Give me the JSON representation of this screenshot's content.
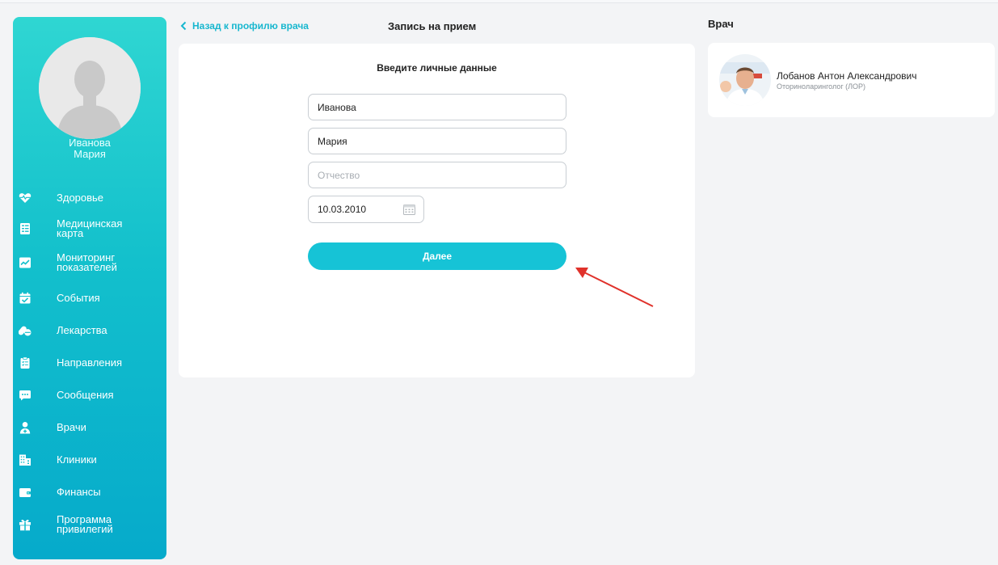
{
  "user": {
    "name": "Иванова\nМария"
  },
  "sidebar": {
    "items": [
      {
        "label": "Здоровье",
        "icon": "heart-pulse-icon"
      },
      {
        "label": "Медицинская\nкарта",
        "icon": "medical-card-icon"
      },
      {
        "label": "Мониторинг\nпоказателей",
        "icon": "monitoring-chart-icon"
      },
      {
        "label": "События",
        "icon": "calendar-check-icon"
      },
      {
        "label": "Лекарства",
        "icon": "pills-icon"
      },
      {
        "label": "Направления",
        "icon": "clipboard-icon"
      },
      {
        "label": "Сообщения",
        "icon": "chat-icon"
      },
      {
        "label": "Врачи",
        "icon": "doctor-icon"
      },
      {
        "label": "Клиники",
        "icon": "building-icon"
      },
      {
        "label": "Финансы",
        "icon": "wallet-icon"
      },
      {
        "label": "Программа\nпривилегий",
        "icon": "gift-icon"
      }
    ]
  },
  "header": {
    "back_label": "Назад к профилю врача",
    "title": "Запись на прием"
  },
  "form": {
    "heading": "Введите личные данные",
    "last_name": "Иванова",
    "first_name": "Мария",
    "patronymic_placeholder": "Отчество",
    "birth_date": "10.03.2010",
    "submit_label": "Далее"
  },
  "doctor": {
    "section_title": "Врач",
    "name": "Лобанов Антон Александрович",
    "specialty": "Оториноларинголог (ЛОР)"
  },
  "colors": {
    "accent": "#16c3d6",
    "link": "#18b7cf",
    "sidebar_top": "#2fd6d2",
    "sidebar_bottom": "#06aacb",
    "annotation_arrow": "#e0322b"
  }
}
